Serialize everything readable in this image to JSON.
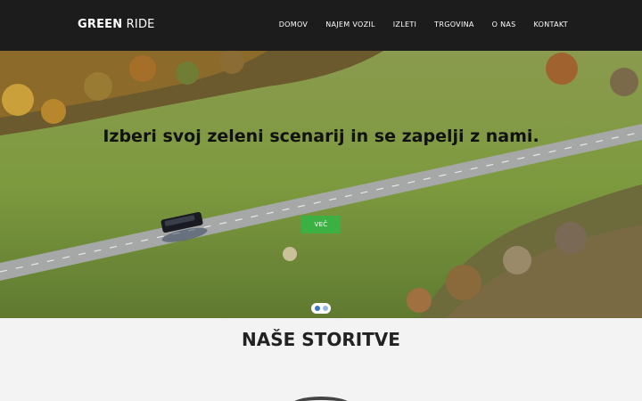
{
  "brand": {
    "strong": "GREEN",
    "light": "RIDE"
  },
  "nav": {
    "links": [
      "DOMOV",
      "NAJEM VOZIL",
      "IZLETI",
      "TRGOVINA",
      "O NAS",
      "KONTAKT"
    ]
  },
  "hero": {
    "heading": "Izberi svoj zeleni scenarij in se zapelji z nami.",
    "button_label": "VEČ",
    "slide_count": 2,
    "active_slide": 1
  },
  "services": {
    "title": "NAŠE STORITVE"
  },
  "colors": {
    "nav_bg": "#1c1c1c",
    "accent_green": "#3cb043",
    "indicator_active": "#3a77c8"
  }
}
